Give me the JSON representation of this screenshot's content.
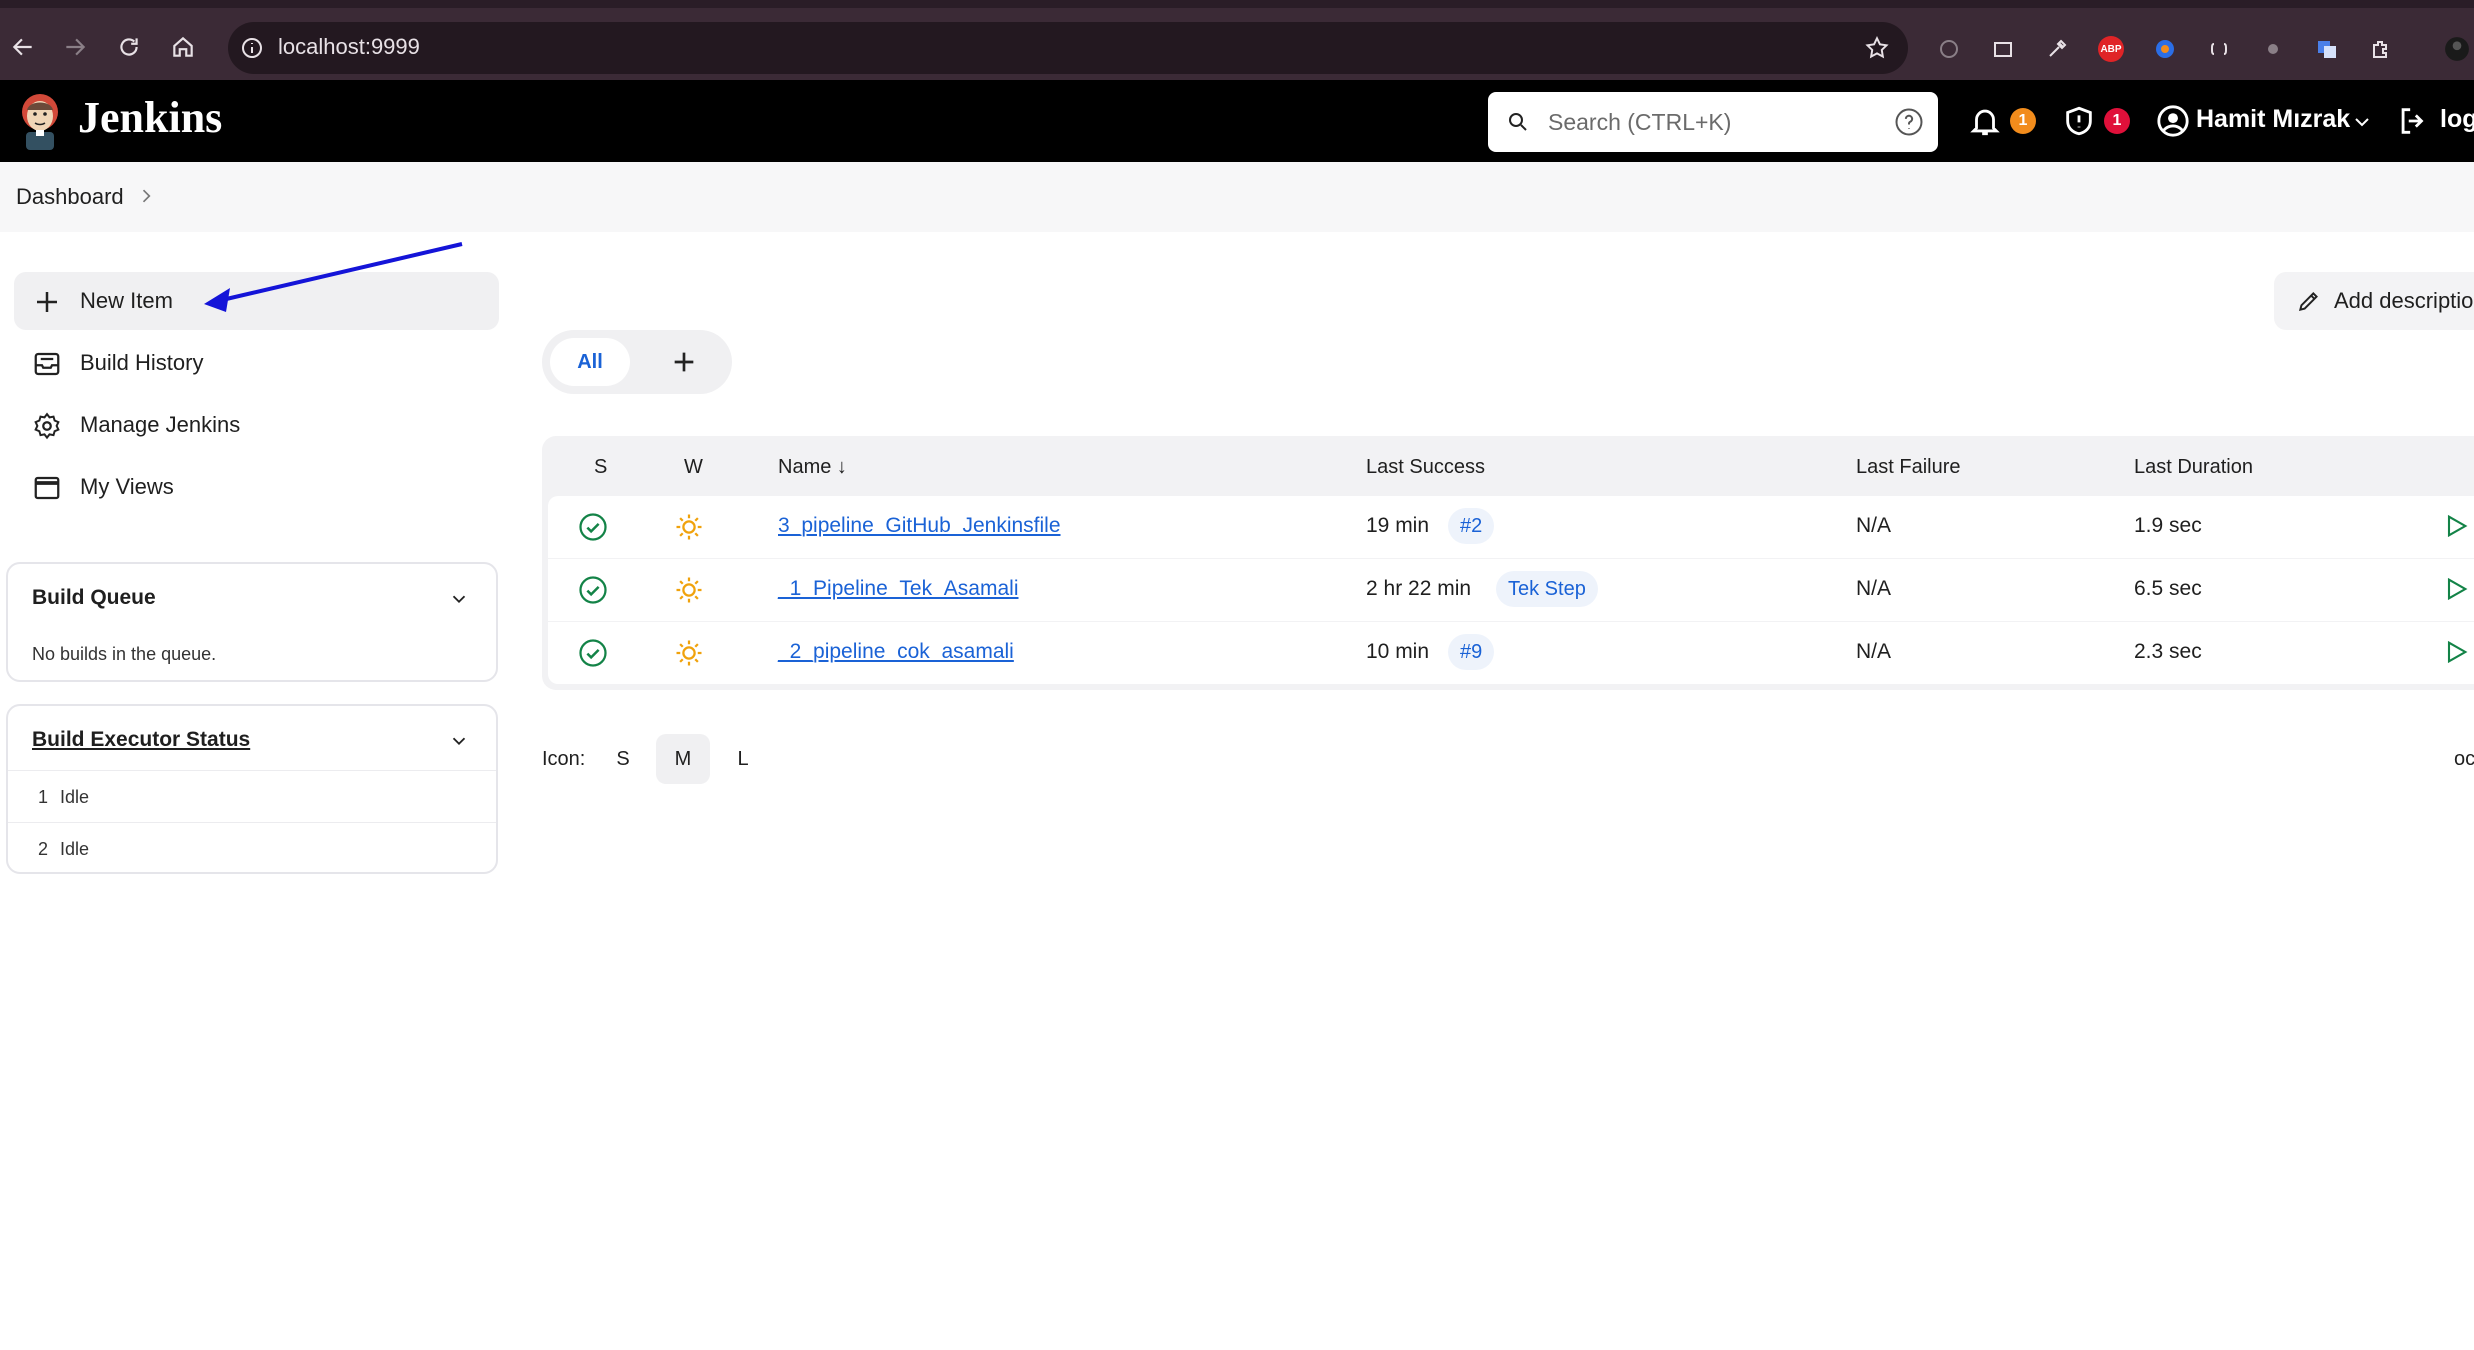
{
  "browser": {
    "url": "localhost:9999"
  },
  "header": {
    "brand": "Jenkins",
    "search_placeholder": "Search (CTRL+K)",
    "notifications_count": "1",
    "security_count": "1",
    "user_name": "Hamit Mızrak",
    "logout_label": "log"
  },
  "breadcrumb": {
    "item": "Dashboard"
  },
  "sidebar": {
    "tasks": [
      {
        "label": "New Item",
        "icon": "plus-icon"
      },
      {
        "label": "Build History",
        "icon": "inbox-icon"
      },
      {
        "label": "Manage Jenkins",
        "icon": "gear-icon"
      },
      {
        "label": "My Views",
        "icon": "window-icon"
      }
    ],
    "build_queue": {
      "title": "Build Queue",
      "empty_text": "No builds in the queue."
    },
    "executors": {
      "title": "Build Executor Status",
      "items": [
        {
          "num": "1",
          "status": "Idle"
        },
        {
          "num": "2",
          "status": "Idle"
        }
      ]
    }
  },
  "main": {
    "add_description": "Add descriptio",
    "tabs": {
      "all": "All"
    },
    "columns": {
      "s": "S",
      "w": "W",
      "name": "Name ↓",
      "last_success": "Last Success",
      "last_failure": "Last Failure",
      "last_duration": "Last Duration"
    },
    "jobs": [
      {
        "name": "3_pipeline_GitHub_Jenkinsfile",
        "last_success": "19 min",
        "build": "#2",
        "last_failure": "N/A",
        "last_duration": "1.9 sec"
      },
      {
        "name": "_1_Pipeline_Tek_Asamali",
        "last_success": "2 hr 22 min",
        "build": "Tek Step",
        "last_failure": "N/A",
        "last_duration": "6.5 sec"
      },
      {
        "name": "_2_pipeline_cok_asamali",
        "last_success": "10 min",
        "build": "#9",
        "last_failure": "N/A",
        "last_duration": "2.3 sec"
      }
    ],
    "icon_size": {
      "label": "Icon:",
      "s": "S",
      "m": "M",
      "l": "L",
      "selected": "M",
      "legend_cut": "oc"
    }
  },
  "colors": {
    "accent": "#1a62d6",
    "success": "#138347",
    "sunny": "#f0a20c",
    "arrow": "#1414d8"
  }
}
